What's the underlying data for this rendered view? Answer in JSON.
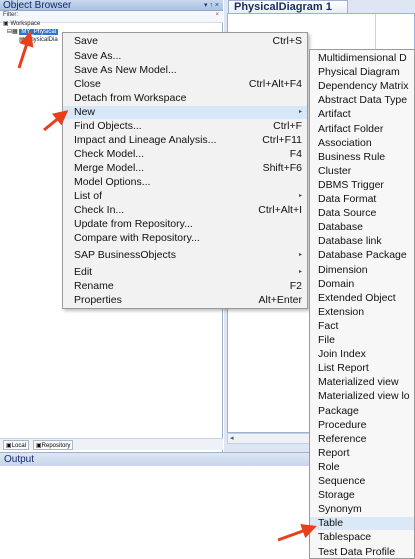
{
  "object_browser": {
    "title": "Object Browser",
    "controls": "▾ ↑ ×",
    "filter_label": "Filter:",
    "filter_close": "×",
    "tree": {
      "workspace": "Workspace",
      "model": "MY_Physical",
      "diagram": "PhysicalDia"
    },
    "tabs": [
      "Local",
      "Repository"
    ]
  },
  "diagram": {
    "tab_title": "PhysicalDiagram 1",
    "scroll_marker": "◂"
  },
  "output": {
    "title": "Output"
  },
  "context_menu": {
    "items": [
      {
        "label": "Save",
        "shortcut": "Ctrl+S"
      },
      {
        "label": "Save As...",
        "shortcut": ""
      },
      {
        "label": "Save As New Model...",
        "shortcut": ""
      },
      {
        "label": "Close",
        "shortcut": "Ctrl+Alt+F4"
      },
      {
        "label": "Detach from Workspace",
        "shortcut": ""
      },
      {
        "label": "New",
        "shortcut": "",
        "submenu": true,
        "highlighted": true
      },
      {
        "label": "Find Objects...",
        "shortcut": "Ctrl+F"
      },
      {
        "label": "Impact and Lineage Analysis...",
        "shortcut": "Ctrl+F11"
      },
      {
        "label": "Check Model...",
        "shortcut": "F4"
      },
      {
        "label": "Merge Model...",
        "shortcut": "Shift+F6"
      },
      {
        "label": "Model Options...",
        "shortcut": ""
      },
      {
        "label": "List of",
        "shortcut": "",
        "submenu": true
      },
      {
        "label": "Check In...",
        "shortcut": "Ctrl+Alt+I"
      },
      {
        "label": "Update from Repository...",
        "shortcut": ""
      },
      {
        "label": "Compare with Repository...",
        "shortcut": ""
      },
      {
        "label": "SAP BusinessObjects",
        "shortcut": "",
        "submenu": true
      },
      {
        "label": "Edit",
        "shortcut": "",
        "submenu": true
      },
      {
        "label": "Rename",
        "shortcut": "F2"
      },
      {
        "label": "Properties",
        "shortcut": "Alt+Enter"
      }
    ]
  },
  "submenu": {
    "items": [
      "Multidimensional D",
      "Physical Diagram",
      "Dependency Matrix",
      "Abstract Data Type",
      "Artifact",
      "Artifact Folder",
      "Association",
      "Business Rule",
      "Cluster",
      "DBMS Trigger",
      "Data Format",
      "Data Source",
      "Database",
      "Database link",
      "Database Package",
      "Dimension",
      "Domain",
      "Extended Object",
      "Extension",
      "Fact",
      "File",
      "Join Index",
      "List Report",
      "Materialized view",
      "Materialized view lo",
      "Package",
      "Procedure",
      "Reference",
      "Report",
      "Role",
      "Sequence",
      "Storage",
      "Synonym",
      "Table",
      "Tablespace",
      "Test Data Profile"
    ],
    "highlighted_item": "Table"
  },
  "colors": {
    "annotation_arrow": "#e8401c",
    "selection": "#2f74d0",
    "menu_highlight": "#d7e7fa"
  }
}
